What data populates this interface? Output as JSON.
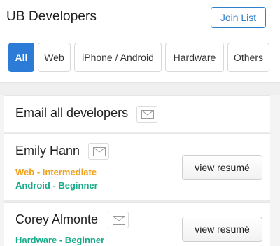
{
  "header": {
    "title": "UB Developers",
    "join_label": "Join List"
  },
  "tabs": [
    {
      "label": "All",
      "active": true
    },
    {
      "label": "Web",
      "active": false
    },
    {
      "label": "iPhone / Android",
      "active": false
    },
    {
      "label": "Hardware",
      "active": false
    },
    {
      "label": "Others",
      "active": false
    }
  ],
  "email_all": {
    "label": "Email all developers",
    "icon": "mail-icon"
  },
  "developers": [
    {
      "name": "Emily Hann",
      "skills": [
        {
          "text": "Web - Intermediate",
          "color": "#f0a21c"
        },
        {
          "text": "Android - Beginner",
          "color": "#17ab8a"
        }
      ],
      "resume_label": "view resumé"
    },
    {
      "name": "Corey Almonte",
      "skills": [
        {
          "text": "Hardware - Beginner",
          "color": "#17ab8a"
        }
      ],
      "resume_label": "view resumé"
    }
  ],
  "colors": {
    "accent": "#2c7bd6",
    "orange": "#f0a21c",
    "teal": "#17ab8a"
  }
}
